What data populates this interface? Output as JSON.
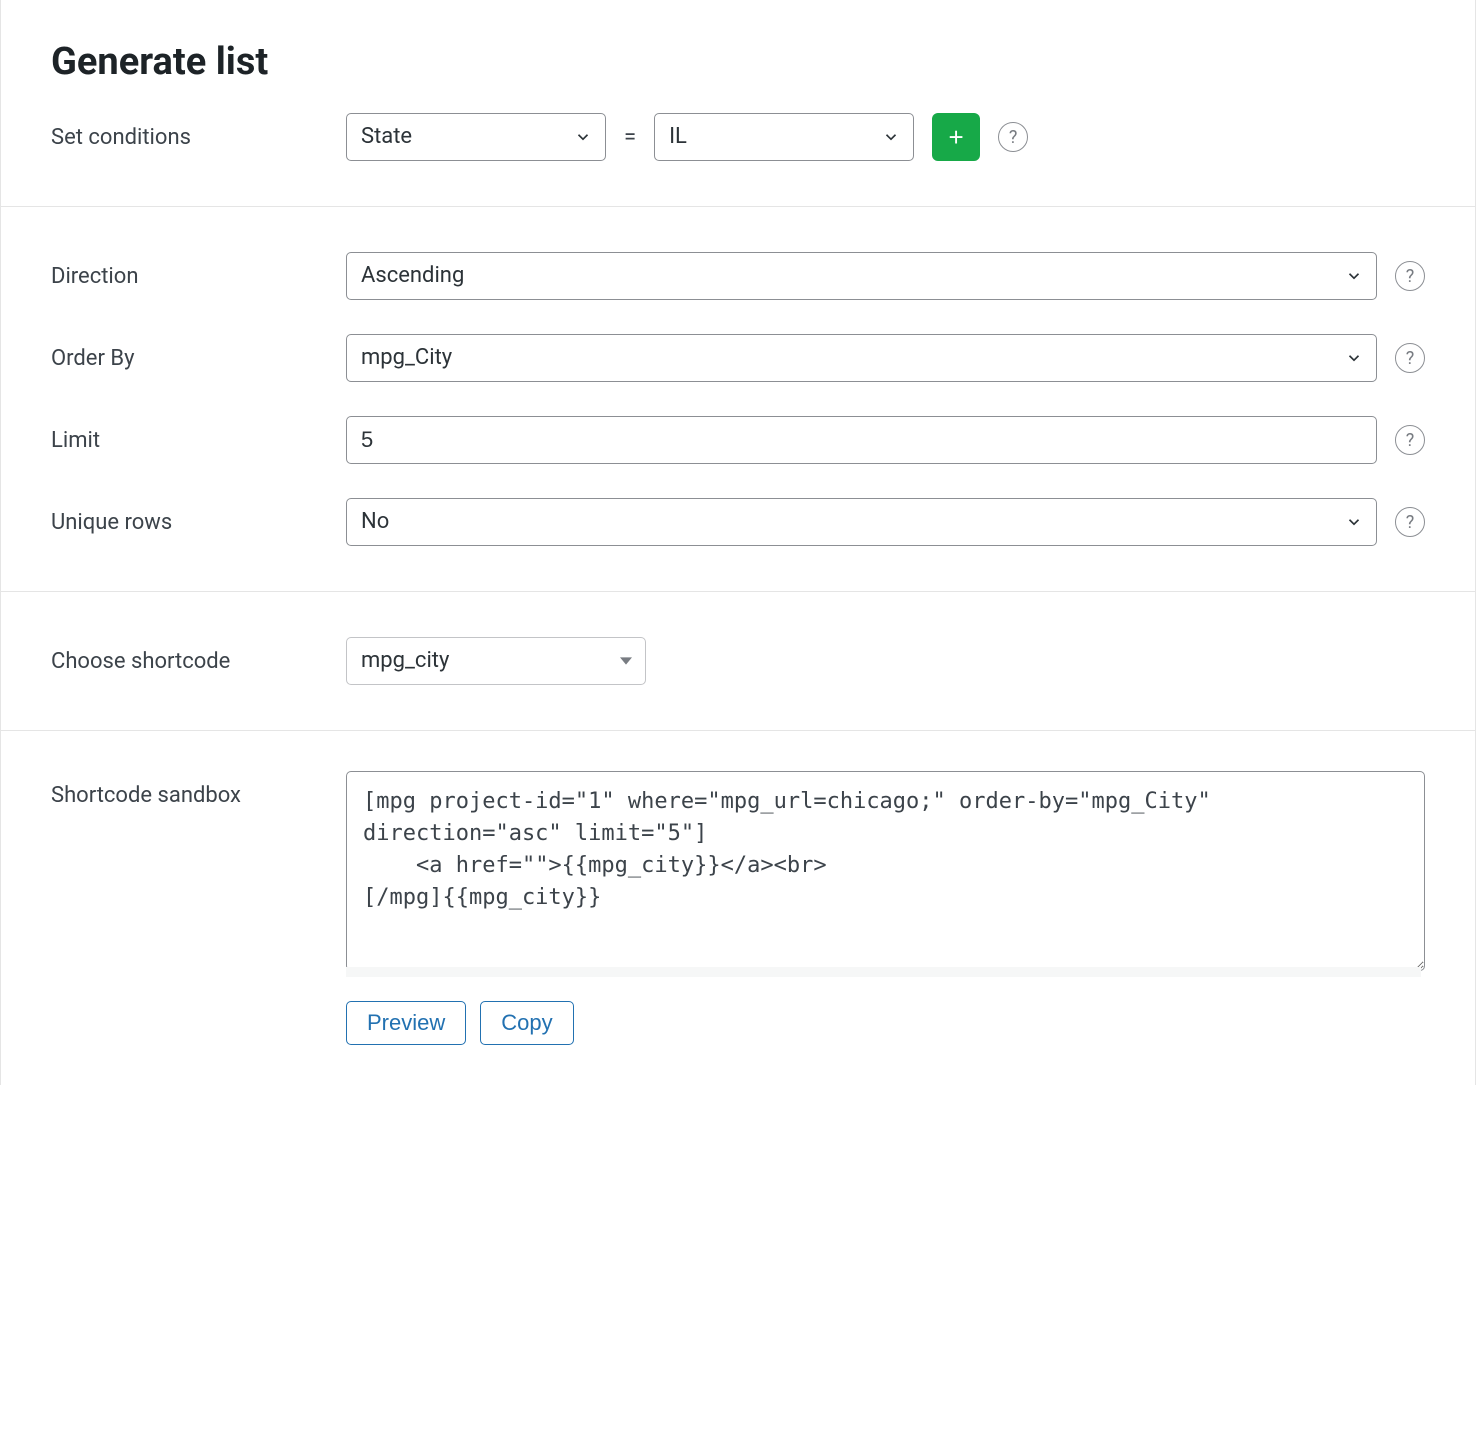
{
  "title": "Generate list",
  "conditions": {
    "label": "Set conditions",
    "field": "State",
    "operator": "=",
    "value": "IL",
    "add_label": "+"
  },
  "direction": {
    "label": "Direction",
    "value": "Ascending"
  },
  "order_by": {
    "label": "Order By",
    "value": "mpg_City"
  },
  "limit": {
    "label": "Limit",
    "value": "5"
  },
  "unique_rows": {
    "label": "Unique rows",
    "value": "No"
  },
  "shortcode_select": {
    "label": "Choose shortcode",
    "value": "mpg_city"
  },
  "sandbox": {
    "label": "Shortcode sandbox",
    "value": "[mpg project-id=\"1\" where=\"mpg_url=chicago;\" order-by=\"mpg_City\" direction=\"asc\" limit=\"5\"]\n    <a href=\"\">{{mpg_city}}</a><br>\n[/mpg]{{mpg_city}}"
  },
  "buttons": {
    "preview": "Preview",
    "copy": "Copy"
  },
  "help_glyph": "?"
}
